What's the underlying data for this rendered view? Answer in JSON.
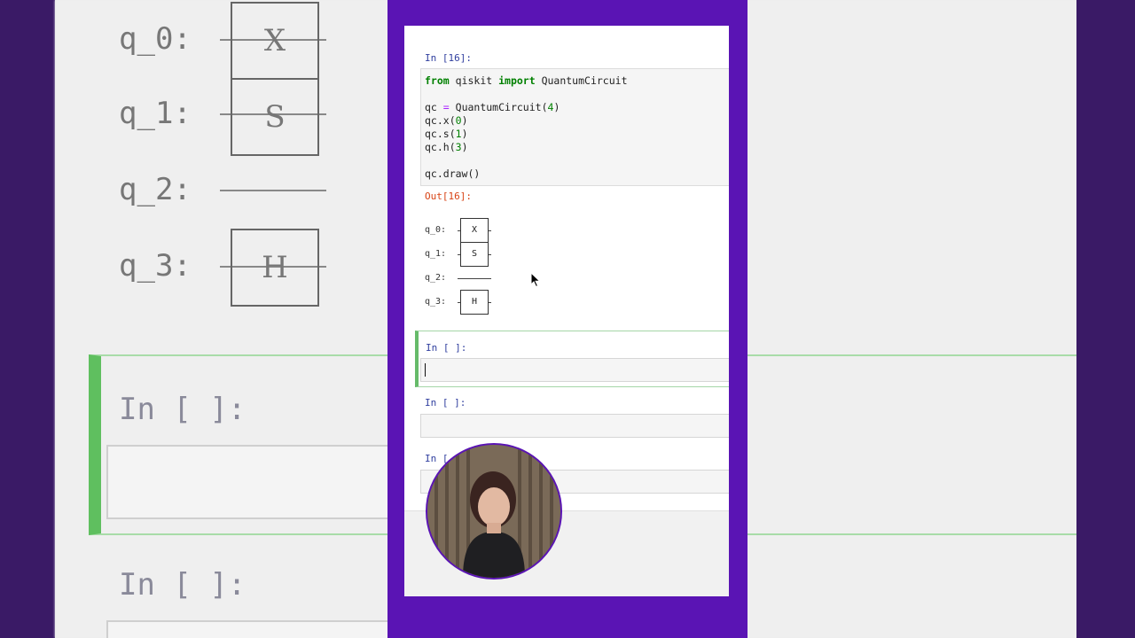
{
  "background": {
    "qubits": [
      "q_0:",
      "q_1:",
      "q_2:",
      "q_3:"
    ],
    "gates": [
      "X",
      "S",
      "H"
    ],
    "in_prompts": [
      "In [ ]:",
      "In [ ]:"
    ]
  },
  "notebook": {
    "cell1": {
      "in_prompt": "In [16]:",
      "code": {
        "line1_kw1": "from",
        "line1_mod": " qiskit ",
        "line1_kw2": "import",
        "line1_name": " QuantumCircuit",
        "line2_a": "qc ",
        "line2_op": "=",
        "line2_b": " QuantumCircuit(",
        "line2_num": "4",
        "line2_c": ")",
        "line3_a": "qc.x(",
        "line3_num": "0",
        "line3_b": ")",
        "line4_a": "qc.s(",
        "line4_num": "1",
        "line4_b": ")",
        "line5_a": "qc.h(",
        "line5_num": "3",
        "line5_b": ")",
        "line6": "qc.draw()"
      },
      "out_prompt": "Out[16]:"
    },
    "circuit": {
      "q0": "q_0:",
      "q1": "q_1:",
      "q2": "q_2:",
      "q3": "q_3:",
      "gate_x": "X",
      "gate_s": "S",
      "gate_h": "H"
    },
    "cell2": {
      "in_prompt": "In [ ]:"
    },
    "cell3": {
      "in_prompt": "In [ ]:"
    },
    "cell4": {
      "in_prompt": "In ["
    }
  },
  "colors": {
    "frame": "#5a14b4",
    "active_cell": "#66bb6a",
    "in_prompt": "#303f9f",
    "out_prompt": "#d84315"
  }
}
